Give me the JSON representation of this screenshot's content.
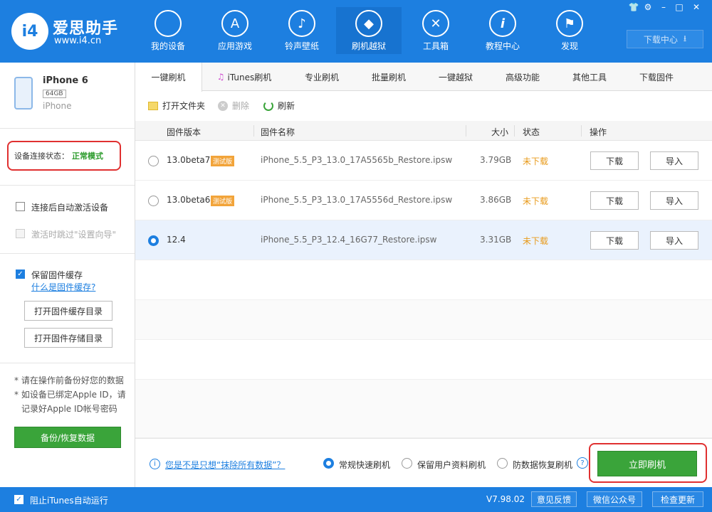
{
  "app": {
    "title": "爱思助手",
    "url": "www.i4.cn",
    "logo_text": "i4"
  },
  "nav": [
    {
      "label": "我的设备",
      "icon": "apple-icon",
      "glyph": ""
    },
    {
      "label": "应用游戏",
      "icon": "appstore-icon",
      "glyph": "A"
    },
    {
      "label": "铃声壁纸",
      "icon": "music-icon",
      "glyph": "♪"
    },
    {
      "label": "刷机越狱",
      "icon": "dropbox-icon",
      "glyph": "◆"
    },
    {
      "label": "工具箱",
      "icon": "tools-icon",
      "glyph": "✕"
    },
    {
      "label": "教程中心",
      "icon": "info-icon",
      "glyph": "i"
    },
    {
      "label": "发现",
      "icon": "flag-icon",
      "glyph": "⚑"
    }
  ],
  "window_controls": [
    "👕",
    "⚙",
    "–",
    "□",
    "✕"
  ],
  "download_center": {
    "label": "下载中心",
    "icon": "⭳"
  },
  "device": {
    "name": "iPhone 6",
    "capacity": "64GB",
    "type": "iPhone",
    "conn_label": "设备连接状态：",
    "conn_status": "正常模式"
  },
  "sidebar": {
    "auto_activate": "连接后自动激活设备",
    "skip_setup": "激活时跳过\"设置向导\"",
    "keep_cache": "保留固件缓存",
    "what_is_cache": "什么是固件缓存?",
    "open_cache_dir": "打开固件缓存目录",
    "open_storage_dir": "打开固件存储目录",
    "notes": [
      "* 请在操作前备份好您的数据",
      "* 如设备已绑定Apple ID，请",
      "记录好Apple ID帐号密码"
    ],
    "backup_btn": "备份/恢复数据"
  },
  "tabs": [
    "一键刷机",
    "iTunes刷机",
    "专业刷机",
    "批量刷机",
    "一键越狱",
    "高级功能",
    "其他工具",
    "下载固件"
  ],
  "toolbar": {
    "open_folder": "打开文件夹",
    "delete": "删除",
    "refresh": "刷新"
  },
  "table": {
    "headers": [
      "固件版本",
      "固件名称",
      "大小",
      "状态",
      "操作"
    ],
    "beta_badge": "测试版",
    "download_btn": "下载",
    "import_btn": "导入",
    "rows": [
      {
        "version": "13.0beta7",
        "beta": true,
        "name": "iPhone_5.5_P3_13.0_17A5565b_Restore.ipsw",
        "size": "3.79GB",
        "status": "未下载",
        "selected": false
      },
      {
        "version": "13.0beta6",
        "beta": true,
        "name": "iPhone_5.5_P3_13.0_17A5556d_Restore.ipsw",
        "size": "3.86GB",
        "status": "未下载",
        "selected": false
      },
      {
        "version": "12.4",
        "beta": false,
        "name": "iPhone_5.5_P3_12.4_16G77_Restore.ipsw",
        "size": "3.31GB",
        "status": "未下载",
        "selected": true
      }
    ]
  },
  "bottom": {
    "erase_link": "您是不是只想“抹除所有数据”？",
    "mode_normal": "常规快速刷机",
    "mode_keep": "保留用户资料刷机",
    "mode_anti": "防数据恢复刷机",
    "help": "?",
    "flash_btn": "立即刷机"
  },
  "status": {
    "block_itunes": "阻止iTunes自动运行",
    "version": "V7.98.02",
    "feedback": "意见反馈",
    "wechat": "微信公众号",
    "update": "检查更新"
  },
  "colors": {
    "brand_blue": "#1d7fe0",
    "green": "#3aa43a",
    "orange": "#e89a1a",
    "highlight_red": "#e03030"
  }
}
